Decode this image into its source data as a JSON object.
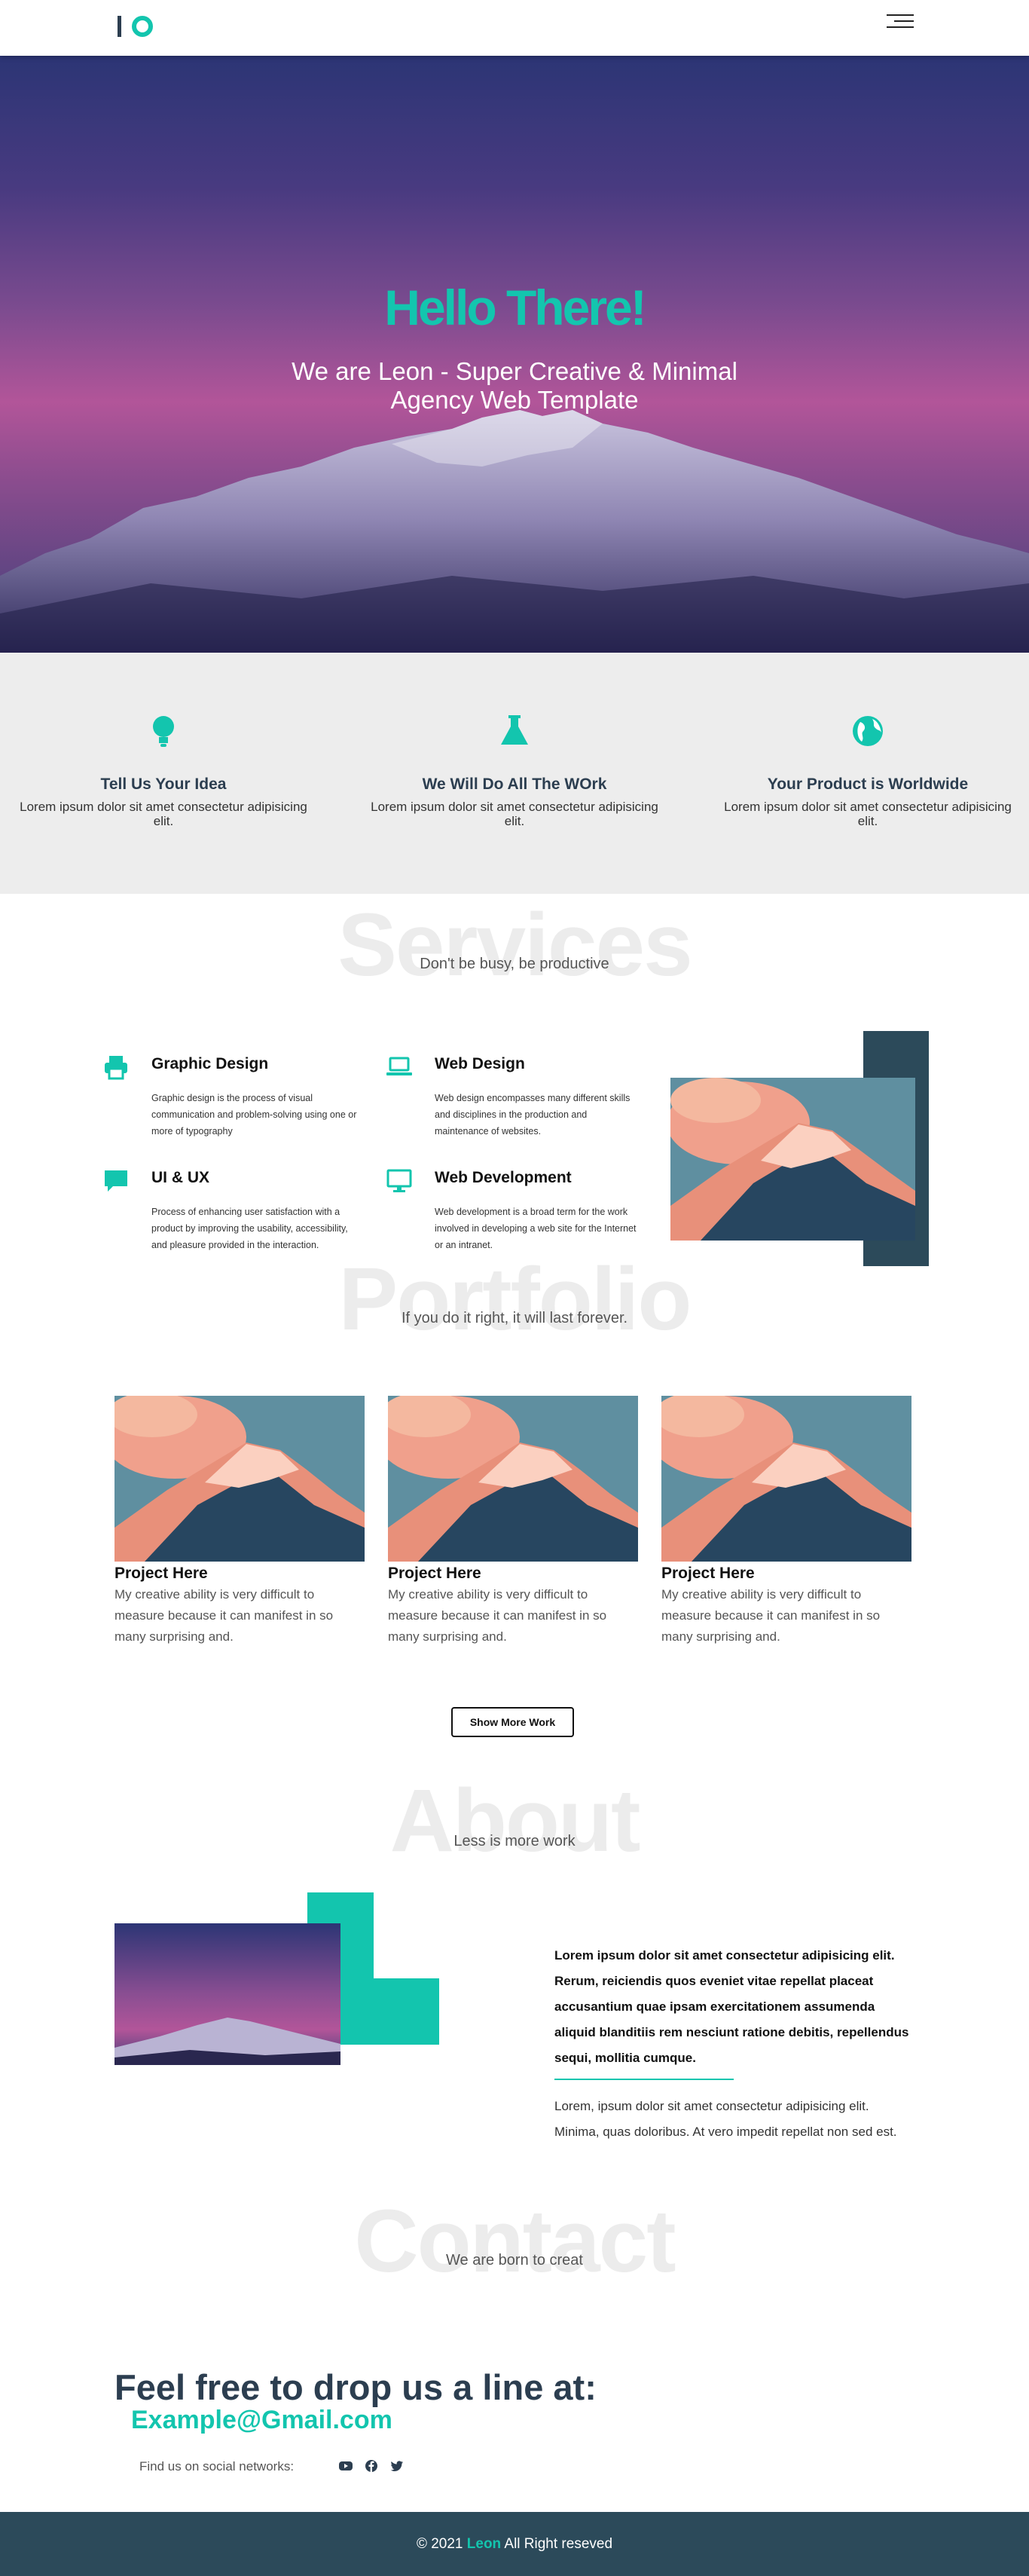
{
  "colors": {
    "accent": "#13c5ae",
    "dark": "#2c3e50",
    "footer": "#2c4a5a",
    "feature_bg": "#ededed"
  },
  "header": {
    "logo_icon": "logo-io",
    "menu_icon": "hamburger-icon"
  },
  "hero": {
    "title": "Hello There!",
    "subtitle": "We are Leon - Super Creative & Minimal Agency Web Template"
  },
  "features": [
    {
      "icon": "lightbulb-icon",
      "title": "Tell Us Your Idea",
      "text": "Lorem ipsum dolor sit amet consectetur adipisicing elit."
    },
    {
      "icon": "flask-icon",
      "title": "We Will Do All The WOrk",
      "text": "Lorem ipsum dolor sit amet consectetur adipisicing elit."
    },
    {
      "icon": "globe-icon",
      "title": "Your Product is Worldwide",
      "text": "Lorem ipsum dolor sit amet consectetur adipisicing elit."
    }
  ],
  "services": {
    "bg_title": "Services",
    "subtitle": "Don't be busy, be productive",
    "items": [
      {
        "icon": "printer-icon",
        "title": "Graphic Design",
        "text": "Graphic design is the process of visual communication and problem-solving using one or more of typography"
      },
      {
        "icon": "laptop-icon",
        "title": "Web Design",
        "text": "Web design encompasses many different skills and disciplines in the production and maintenance of websites."
      },
      {
        "icon": "chat-icon",
        "title": "UI & UX",
        "text": "Process of enhancing user satisfaction with a product by improving the usability, accessibility, and pleasure provided in the interaction."
      },
      {
        "icon": "monitor-icon",
        "title": "Web Development",
        "text": "Web development is a broad term for the work involved in developing a web site for the Internet or an intranet."
      }
    ]
  },
  "portfolio": {
    "bg_title": "Portfolio",
    "subtitle": "If you do it right, it will last forever.",
    "items": [
      {
        "title": "Project Here",
        "text": "My creative ability is very difficult to measure because it can manifest in so many surprising and."
      },
      {
        "title": "Project Here",
        "text": "My creative ability is very difficult to measure because it can manifest in so many surprising and."
      },
      {
        "title": "Project Here",
        "text": "My creative ability is very difficult to measure because it can manifest in so many surprising and."
      }
    ],
    "button": "Show More Work"
  },
  "about": {
    "bg_title": "About",
    "subtitle": "Less is more work",
    "bold_text": "Lorem ipsum dolor sit amet consectetur adipisicing elit. Rerum, reiciendis quos eveniet vitae repellat placeat accusantium quae ipsam exercitationem assumenda aliquid blanditiis rem nesciunt ratione debitis, repellendus sequi, mollitia cumque.",
    "text": "Lorem, ipsum dolor sit amet consectetur adipisicing elit. Minima, quas doloribus. At vero impedit repellat non sed est."
  },
  "contact": {
    "bg_title": "Contact",
    "subtitle": "We are born to creat",
    "title": "Feel free to drop us a line at:",
    "email": "Example@Gmail.com",
    "social_label": "Find us on social networks:",
    "social_icons": [
      "youtube-icon",
      "facebook-icon",
      "twitter-icon"
    ]
  },
  "footer": {
    "prefix": "© 2021",
    "brand": "Leon",
    "suffix": "All Right reseved"
  }
}
